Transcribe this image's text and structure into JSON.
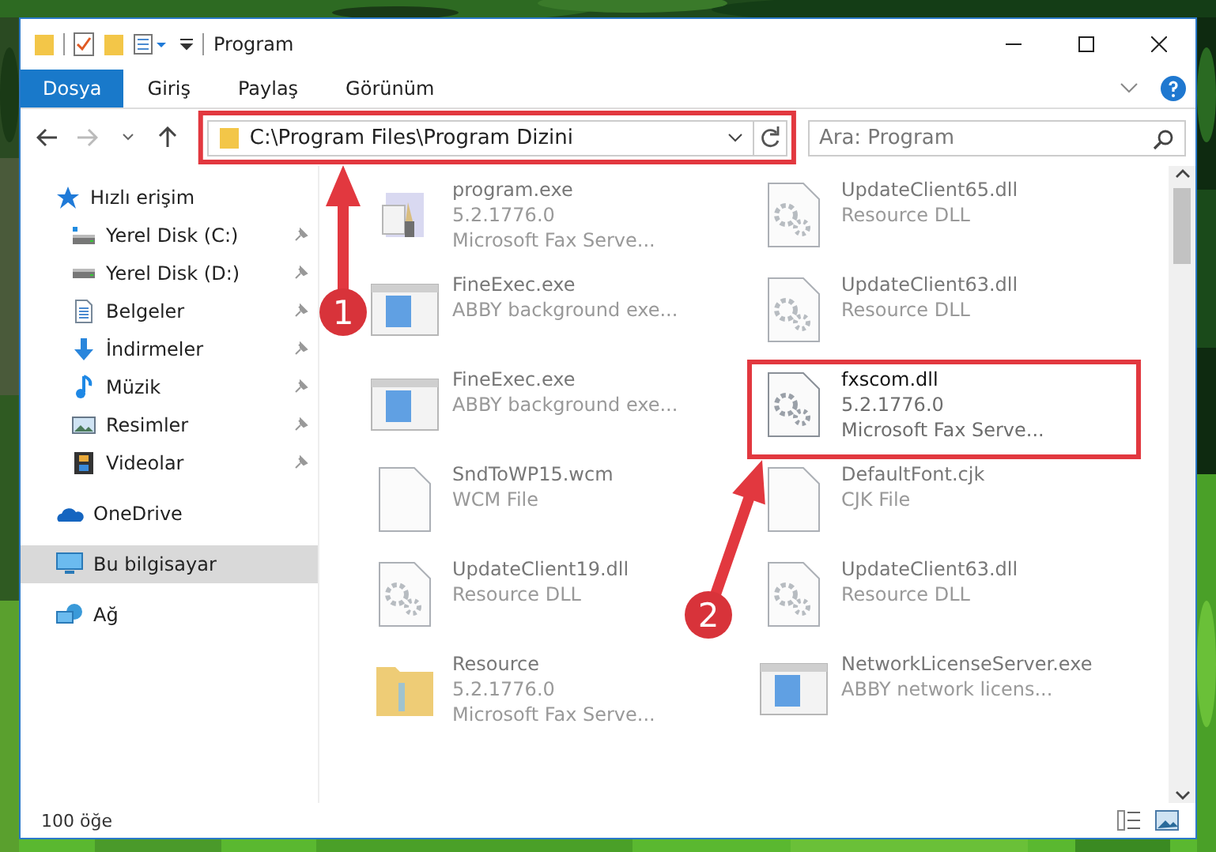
{
  "window": {
    "title": "Program"
  },
  "ribbon_tabs": [
    {
      "label": "Dosya",
      "selected": true
    },
    {
      "label": "Giriş",
      "selected": false
    },
    {
      "label": "Paylaş",
      "selected": false
    },
    {
      "label": "Görünüm",
      "selected": false
    }
  ],
  "address_bar": {
    "path": "C:\\Program Files\\Program Dizini",
    "highlighted": true
  },
  "search": {
    "placeholder": "Ara: Program"
  },
  "sidebar": {
    "items": [
      {
        "label": "Hızlı erişim",
        "kind": "star",
        "selected": false,
        "pinned": false,
        "children": [
          {
            "label": "Yerel Disk (C:)",
            "kind": "drive-os",
            "selected": false,
            "pinned": true
          },
          {
            "label": "Yerel Disk (D:)",
            "kind": "drive",
            "selected": false,
            "pinned": true
          },
          {
            "label": "Belgeler",
            "kind": "docs",
            "selected": false,
            "pinned": true
          },
          {
            "label": "İndirmeler",
            "kind": "download",
            "selected": false,
            "pinned": true
          },
          {
            "label": "Müzik",
            "kind": "music",
            "selected": false,
            "pinned": true
          },
          {
            "label": "Resimler",
            "kind": "pictures",
            "selected": false,
            "pinned": true
          },
          {
            "label": "Videolar",
            "kind": "videos",
            "selected": false,
            "pinned": true
          }
        ]
      },
      {
        "label": "OneDrive",
        "kind": "cloud",
        "selected": false,
        "pinned": false
      },
      {
        "label": "Bu bilgisayar",
        "kind": "pc",
        "selected": true,
        "pinned": false
      },
      {
        "label": "Ağ",
        "kind": "network",
        "selected": false,
        "pinned": false
      }
    ]
  },
  "files": [
    {
      "name": "program.exe",
      "lines": [
        "5.2.1776.0",
        "Microsoft Fax Serve..."
      ],
      "kind": "app",
      "blurred": true,
      "highlighted": false
    },
    {
      "name": "UpdateClient65.dll",
      "lines": [
        "Resource DLL"
      ],
      "kind": "dll",
      "blurred": true,
      "highlighted": false
    },
    {
      "name": "FineExec.exe",
      "lines": [
        "ABBY background exe..."
      ],
      "kind": "window",
      "blurred": true,
      "highlighted": false
    },
    {
      "name": "UpdateClient63.dll",
      "lines": [
        "Resource DLL"
      ],
      "kind": "dll",
      "blurred": true,
      "highlighted": false
    },
    {
      "name": "FineExec.exe",
      "lines": [
        "ABBY background exe..."
      ],
      "kind": "window",
      "blurred": true,
      "highlighted": false
    },
    {
      "name": "fxscom.dll",
      "lines": [
        "5.2.1776.0",
        "Microsoft Fax Serve..."
      ],
      "kind": "dll",
      "blurred": false,
      "highlighted": true
    },
    {
      "name": "SndToWP15.wcm",
      "lines": [
        "WCM File"
      ],
      "kind": "blank",
      "blurred": true,
      "highlighted": false
    },
    {
      "name": "DefaultFont.cjk",
      "lines": [
        "CJK File"
      ],
      "kind": "blank",
      "blurred": true,
      "highlighted": false
    },
    {
      "name": "UpdateClient19.dll",
      "lines": [
        "Resource DLL"
      ],
      "kind": "dll",
      "blurred": true,
      "highlighted": false
    },
    {
      "name": "UpdateClient63.dll",
      "lines": [
        "Resource DLL"
      ],
      "kind": "dll",
      "blurred": true,
      "highlighted": false
    },
    {
      "name": "Resource",
      "lines": [
        "5.2.1776.0",
        "Microsoft Fax Serve..."
      ],
      "kind": "folder",
      "blurred": true,
      "highlighted": false
    },
    {
      "name": "NetworkLicenseServer.exe",
      "lines": [
        "ABBY network licens..."
      ],
      "kind": "window",
      "blurred": true,
      "highlighted": false
    }
  ],
  "status_bar": {
    "count": "100 öğe"
  },
  "annotations": [
    {
      "number": "1"
    },
    {
      "number": "2"
    }
  ]
}
